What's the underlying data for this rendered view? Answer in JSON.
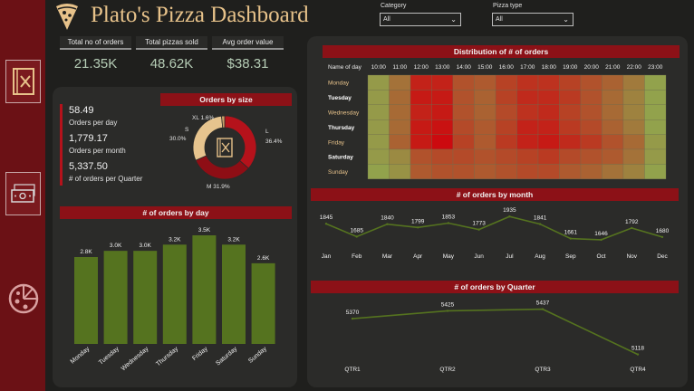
{
  "header": {
    "title": "Plato's Pizza Dashboard",
    "brand_color": "#e7c28a",
    "accent_color": "#8c1117"
  },
  "filters": {
    "category": {
      "label": "Category",
      "selected": "All"
    },
    "pizza_type": {
      "label": "Pizza type",
      "selected": "All"
    }
  },
  "sidebar": {
    "items": [
      {
        "icon": "menu-book-icon",
        "active": true
      },
      {
        "icon": "banknote-icon",
        "active": false
      },
      {
        "icon": "pizza-icon",
        "active": false
      }
    ]
  },
  "kpis": [
    {
      "label": "Total no of orders",
      "value": "21.35K"
    },
    {
      "label": "Total pizzas sold",
      "value": "48.62K"
    },
    {
      "label": "Avg order value",
      "value": "$38.31"
    }
  ],
  "stats": [
    {
      "value": "58.49",
      "label": "Orders per day"
    },
    {
      "value": "1,779.17",
      "label": "Orders per month"
    },
    {
      "value": "5,337.50",
      "label": "# of orders per Quarter"
    }
  ],
  "charts": {
    "orders_by_size": {
      "type": "pie",
      "title": "Orders by size",
      "labels": [
        "L",
        "M",
        "S",
        "XL"
      ],
      "values": [
        36.4,
        31.9,
        30.0,
        1.6
      ],
      "value_labels": [
        "36.4%",
        "M 31.9%",
        "30.0%",
        "XL 1.6%"
      ],
      "slice_names": [
        "L",
        "M",
        "S",
        "XL"
      ],
      "colors": [
        "#b5121b",
        "#8e0e15",
        "#e6c48e",
        "#c9a06a"
      ]
    },
    "orders_by_day": {
      "type": "bar",
      "title": "# of orders by day",
      "categories": [
        "Monday",
        "Tuesday",
        "Wednesday",
        "Thursday",
        "Friday",
        "Saturday",
        "Sunday"
      ],
      "values": [
        2.8,
        3.0,
        3.0,
        3.2,
        3.5,
        3.2,
        2.6
      ],
      "value_labels": [
        "2.8K",
        "3.0K",
        "3.0K",
        "3.2K",
        "3.5K",
        "3.2K",
        "2.6K"
      ],
      "ylim": [
        0,
        3.5
      ],
      "color": "#55731f"
    },
    "heatmap": {
      "type": "heatmap",
      "title": "Distribution of # of orders",
      "corner_label": "Name of day",
      "x": [
        "10:00",
        "11:00",
        "12:00",
        "13:00",
        "14:00",
        "15:00",
        "16:00",
        "17:00",
        "18:00",
        "19:00",
        "20:00",
        "21:00",
        "22:00",
        "23:00"
      ],
      "y": [
        "Monday",
        "Tuesday",
        "Wednesday",
        "Thursday",
        "Friday",
        "Saturday",
        "Sunday"
      ],
      "values": [
        [
          0.1,
          0.35,
          0.85,
          0.85,
          0.55,
          0.5,
          0.65,
          0.75,
          0.75,
          0.65,
          0.55,
          0.45,
          0.3,
          0.05
        ],
        [
          0.1,
          0.4,
          0.9,
          0.9,
          0.55,
          0.45,
          0.65,
          0.8,
          0.8,
          0.7,
          0.55,
          0.4,
          0.25,
          0.05
        ],
        [
          0.1,
          0.4,
          0.85,
          0.9,
          0.55,
          0.45,
          0.6,
          0.75,
          0.8,
          0.65,
          0.55,
          0.4,
          0.25,
          0.05
        ],
        [
          0.1,
          0.4,
          0.9,
          0.95,
          0.6,
          0.5,
          0.65,
          0.85,
          0.85,
          0.7,
          0.6,
          0.45,
          0.3,
          0.05
        ],
        [
          0.1,
          0.45,
          0.9,
          1.0,
          0.65,
          0.5,
          0.7,
          0.85,
          0.9,
          0.8,
          0.7,
          0.55,
          0.4,
          0.1
        ],
        [
          0.1,
          0.2,
          0.55,
          0.6,
          0.6,
          0.55,
          0.6,
          0.65,
          0.7,
          0.6,
          0.55,
          0.5,
          0.35,
          0.1
        ],
        [
          0.05,
          0.15,
          0.5,
          0.55,
          0.55,
          0.5,
          0.55,
          0.6,
          0.6,
          0.5,
          0.45,
          0.35,
          0.25,
          0.05
        ]
      ],
      "color_low": "#8faa4f",
      "color_high": "#cc0a0f",
      "x_label_color": "#eeeeee",
      "y_label_color": "#e7c28a"
    },
    "orders_by_month": {
      "type": "line",
      "title": "# of orders by month",
      "categories": [
        "Jan",
        "Feb",
        "Mar",
        "Apr",
        "May",
        "Jun",
        "Jul",
        "Aug",
        "Sep",
        "Oct",
        "Nov",
        "Dec"
      ],
      "values": [
        1845,
        1685,
        1840,
        1799,
        1853,
        1773,
        1935,
        1841,
        1661,
        1646,
        1792,
        1680
      ],
      "ylim": [
        1600,
        1960
      ],
      "color": "#55731f"
    },
    "orders_by_quarter": {
      "type": "line",
      "title": "# of orders by Quarter",
      "categories": [
        "QTR1",
        "QTR2",
        "QTR3",
        "QTR4"
      ],
      "values": [
        5370,
        5425,
        5437,
        5118
      ],
      "ylim": [
        5090,
        5460
      ],
      "color": "#55731f"
    }
  }
}
